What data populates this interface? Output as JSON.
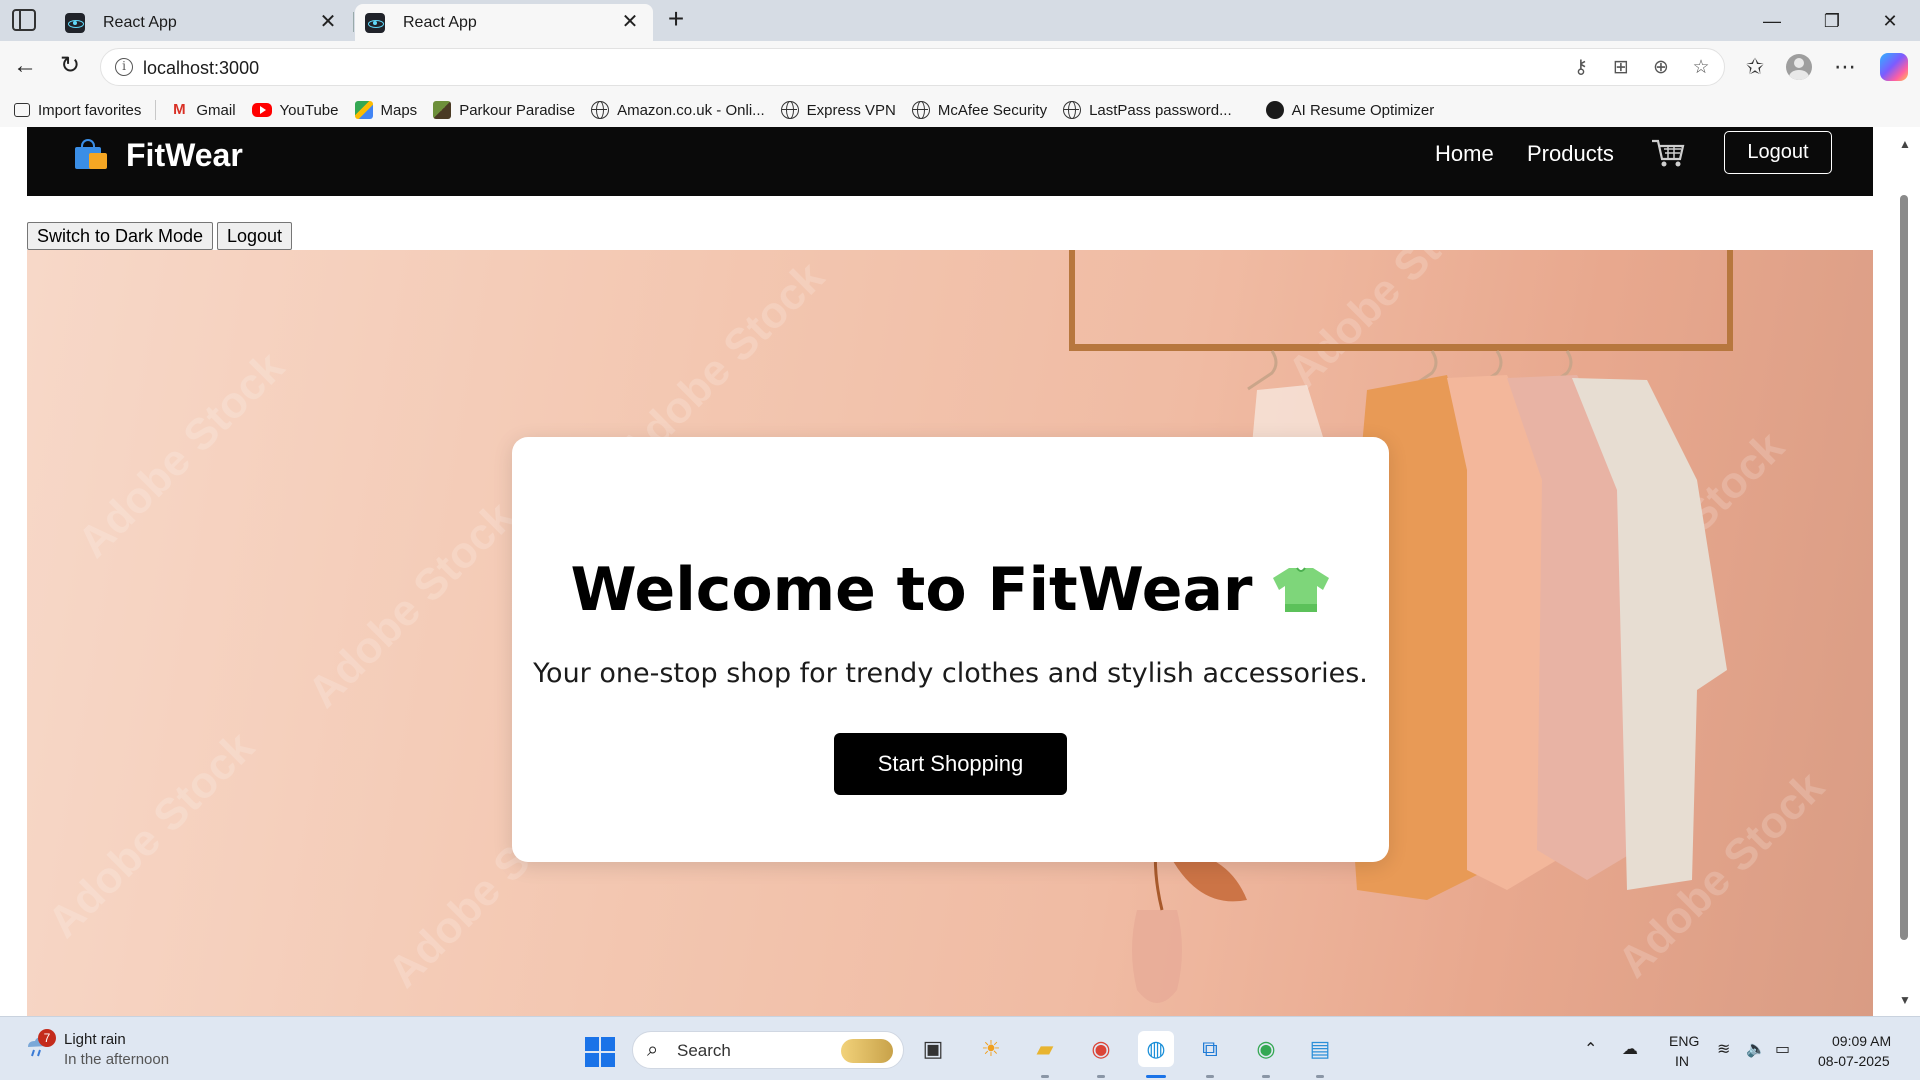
{
  "browser": {
    "tabs": [
      {
        "title": "React App",
        "active": false
      },
      {
        "title": "React App",
        "active": true
      }
    ],
    "address": "localhost:3000",
    "bookmarks": [
      {
        "label": "Import favorites",
        "icon": "import-icon"
      },
      {
        "label": "Gmail",
        "icon": "gmail-icon"
      },
      {
        "label": "YouTube",
        "icon": "youtube-icon"
      },
      {
        "label": "Maps",
        "icon": "maps-icon"
      },
      {
        "label": "Parkour Paradise",
        "icon": "cube-icon"
      },
      {
        "label": "Amazon.co.uk - Onli...",
        "icon": "globe-icon"
      },
      {
        "label": "Express VPN",
        "icon": "globe-icon"
      },
      {
        "label": "McAfee Security",
        "icon": "globe-icon"
      },
      {
        "label": "LastPass password...",
        "icon": "globe-icon"
      },
      {
        "label": "AI Resume Optimizer",
        "icon": "ai-icon"
      }
    ]
  },
  "site": {
    "brand": "FitWear",
    "nav": {
      "home": "Home",
      "products": "Products",
      "logout": "Logout"
    },
    "controls": {
      "dark_mode": "Switch to Dark Mode",
      "logout": "Logout"
    },
    "hero": {
      "title": "Welcome to FitWear",
      "subtitle": "Your one-stop shop for trendy clothes and stylish accessories.",
      "cta": "Start Shopping",
      "watermark": "Adobe Stock"
    },
    "colors": {
      "navbar": "#0a0a0a",
      "cta": "#000000",
      "hero_bg": "#f3c7b1"
    }
  },
  "taskbar": {
    "weather": {
      "badge": "7",
      "condition": "Light rain",
      "detail": "In the afternoon"
    },
    "search_placeholder": "Search",
    "lang": {
      "line1": "ENG",
      "line2": "IN"
    },
    "clock": {
      "time": "09:09 AM",
      "date": "08-07-2025"
    }
  }
}
